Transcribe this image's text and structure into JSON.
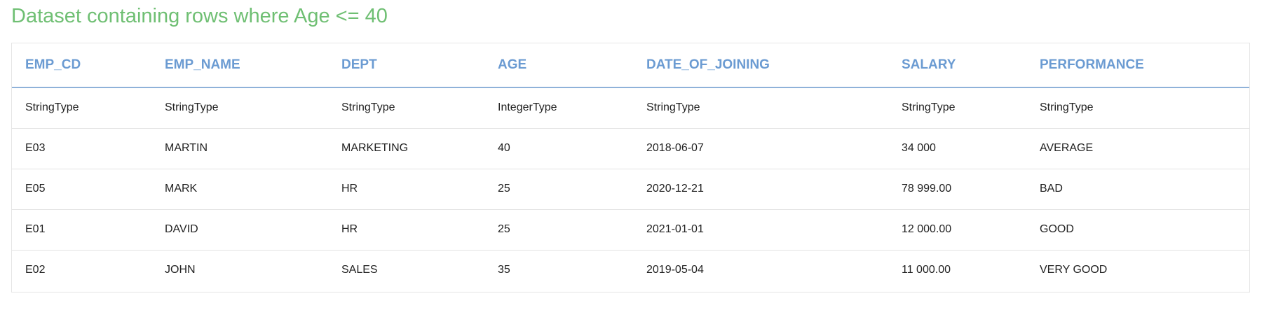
{
  "title": "Dataset containing rows where Age <= 40",
  "table": {
    "columns": [
      "EMP_CD",
      "EMP_NAME",
      "DEPT",
      "AGE",
      "DATE_OF_JOINING",
      "SALARY",
      "PERFORMANCE"
    ],
    "types": [
      "StringType",
      "StringType",
      "StringType",
      "IntegerType",
      "StringType",
      "StringType",
      "StringType"
    ],
    "rows": [
      [
        "E03",
        "MARTIN",
        "MARKETING",
        "40",
        "2018-06-07",
        "34 000",
        "AVERAGE"
      ],
      [
        "E05",
        "MARK",
        "HR",
        "25",
        "2020-12-21",
        "78 999.00",
        "BAD"
      ],
      [
        "E01",
        "DAVID",
        "HR",
        "25",
        "2021-01-01",
        "12 000.00",
        "GOOD"
      ],
      [
        "E02",
        "JOHN",
        "SALES",
        "35",
        "2019-05-04",
        "11 000.00",
        "VERY GOOD"
      ]
    ]
  },
  "colors": {
    "title": "#6fbf73",
    "header_text": "#6b9bd2",
    "header_border": "#8fb2d9",
    "row_border": "#e3e3e3"
  }
}
